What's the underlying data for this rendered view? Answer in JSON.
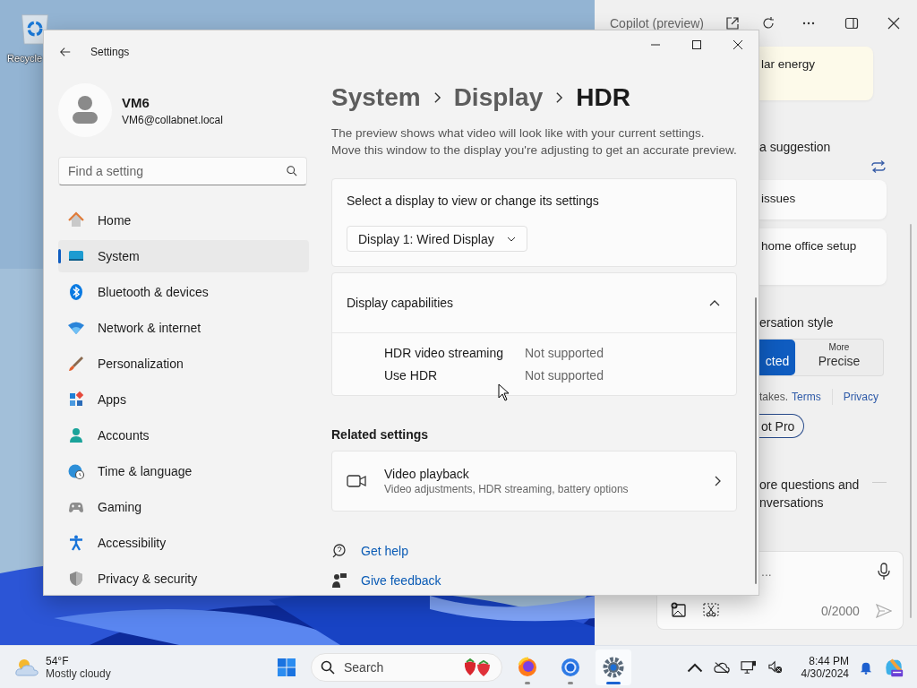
{
  "desktop": {
    "icons": [
      {
        "label": "Recycle"
      }
    ]
  },
  "settings_window": {
    "title": "Settings",
    "account": {
      "name": "VM6",
      "email": "VM6@collabnet.local"
    },
    "search": {
      "placeholder": "Find a setting"
    },
    "nav": [
      {
        "label": "Home",
        "selected": false
      },
      {
        "label": "System",
        "selected": true
      },
      {
        "label": "Bluetooth & devices",
        "selected": false
      },
      {
        "label": "Network & internet",
        "selected": false
      },
      {
        "label": "Personalization",
        "selected": false
      },
      {
        "label": "Apps",
        "selected": false
      },
      {
        "label": "Accounts",
        "selected": false
      },
      {
        "label": "Time & language",
        "selected": false
      },
      {
        "label": "Gaming",
        "selected": false
      },
      {
        "label": "Accessibility",
        "selected": false
      },
      {
        "label": "Privacy & security",
        "selected": false
      }
    ],
    "breadcrumb": [
      "System",
      "Display",
      "HDR"
    ],
    "description": "The preview shows what video will look like with your current settings. Move this window to the display you're adjusting to get an accurate preview.",
    "display_select": {
      "label": "Select a display to view or change its settings",
      "value": "Display 1: Wired Display"
    },
    "capabilities": {
      "title": "Display capabilities",
      "expanded": true,
      "rows": [
        {
          "name": "HDR video streaming",
          "value": "Not supported"
        },
        {
          "name": "Use HDR",
          "value": "Not supported"
        }
      ]
    },
    "related": {
      "heading": "Related settings",
      "items": [
        {
          "title": "Video playback",
          "subtitle": "Video adjustments, HDR streaming, battery options"
        }
      ]
    },
    "links": [
      "Get help",
      "Give feedback"
    ]
  },
  "copilot": {
    "title": "Copilot (preview)",
    "card_1": "lar energy",
    "prompt": "a suggestion",
    "card_2": "issues",
    "card_3": "home office setup",
    "style_heading": "ersation style",
    "styles": [
      {
        "label": "cted",
        "selected": true
      },
      {
        "caption": "More",
        "label": "Precise",
        "selected": false
      }
    ],
    "notice": "takes.",
    "terms_link": "Terms",
    "privacy_link": "Privacy",
    "pro_button": "ot Pro",
    "info_lines": [
      "ore questions and",
      "nversations"
    ],
    "input": {
      "placeholder": "...",
      "counter": "0/2000"
    }
  },
  "taskbar": {
    "weather": {
      "temp": "54°F",
      "condition": "Mostly cloudy"
    },
    "search": {
      "placeholder": "Search"
    },
    "apps": [
      {
        "selected": false
      },
      {
        "selected": false
      },
      {
        "selected": true
      }
    ],
    "time": "8:44 PM",
    "date": "4/30/2024"
  }
}
